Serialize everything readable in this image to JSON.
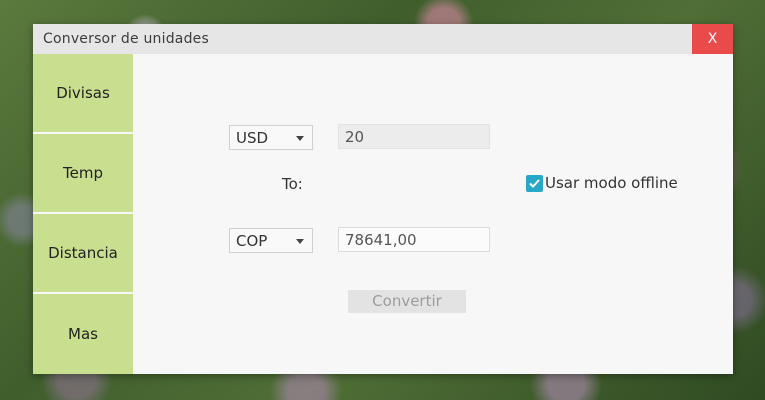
{
  "window": {
    "title": "Conversor de unidades",
    "close_label": "X"
  },
  "sidebar": {
    "items": [
      {
        "label": "Divisas"
      },
      {
        "label": "Temp"
      },
      {
        "label": "Distancia"
      },
      {
        "label": "Mas"
      }
    ]
  },
  "converter": {
    "from_currency": "USD",
    "from_value": "20",
    "to_label": "To:",
    "to_currency": "COP",
    "to_value": "78641,00",
    "convert_label": "Convertir"
  },
  "offline": {
    "label": "Usar modo offline",
    "checked": true
  },
  "colors": {
    "sidebar_item": "#c8df8f",
    "close_button": "#e94b4b",
    "checkbox_accent": "#27a8c6"
  }
}
